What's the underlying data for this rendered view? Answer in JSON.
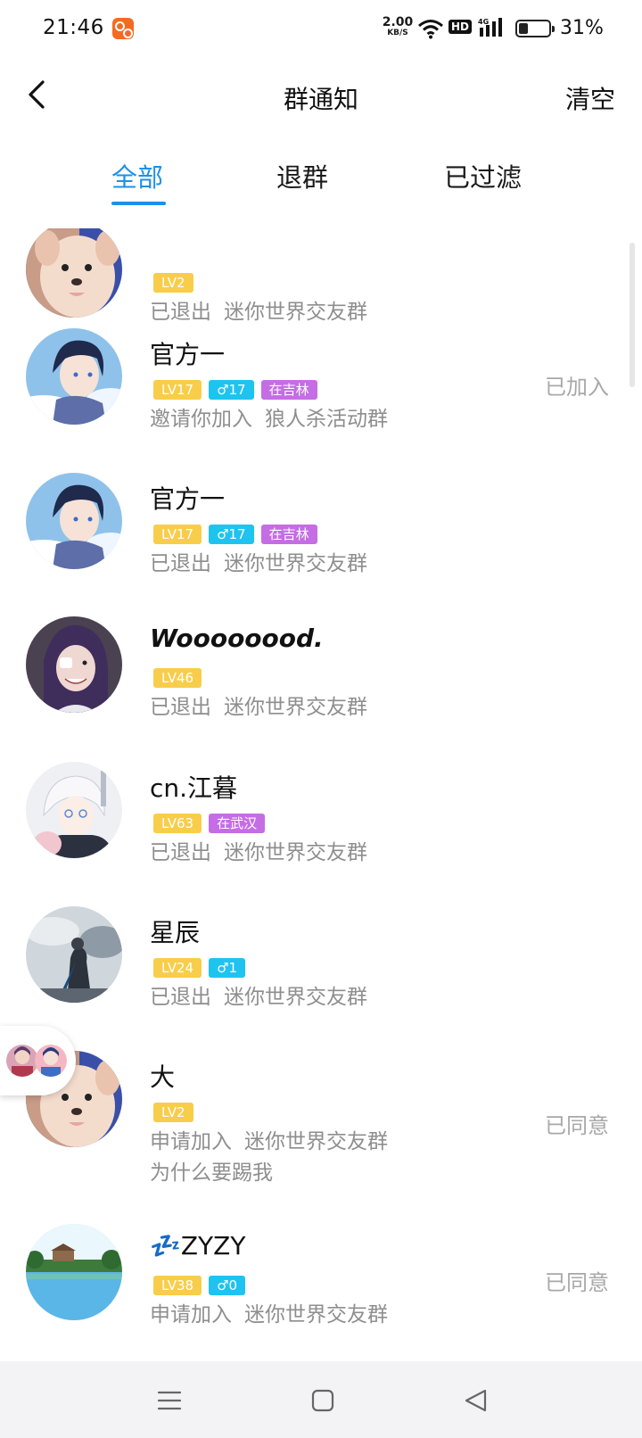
{
  "status_bar": {
    "time": "21:46",
    "net_speed": "2.00",
    "net_unit": "KB/S",
    "hd": "HD",
    "battery_pct": "31%",
    "battery_level": 0.31
  },
  "header": {
    "title": "群通知",
    "clear_label": "清空"
  },
  "tabs": [
    {
      "label": "全部",
      "active": true
    },
    {
      "label": "退群",
      "active": false
    },
    {
      "label": "已过滤",
      "active": false
    }
  ],
  "list": [
    {
      "nickname": "",
      "badges": {
        "lv": "LV2"
      },
      "action": "已退出",
      "group": "迷你世界交友群",
      "status": "",
      "avatar": "dog"
    },
    {
      "nickname": "官方一",
      "badges": {
        "lv": "LV17",
        "sex": "♂17",
        "loc": "在吉林"
      },
      "action": "邀请你加入",
      "group": "狼人杀活动群",
      "status": "已加入",
      "avatar": "anime-boy"
    },
    {
      "nickname": "官方一",
      "badges": {
        "lv": "LV17",
        "sex": "♂17",
        "loc": "在吉林"
      },
      "action": "已退出",
      "group": "迷你世界交友群",
      "status": "",
      "avatar": "anime-boy"
    },
    {
      "nickname": "Woooooood.",
      "badges": {
        "lv": "LV46"
      },
      "action": "已退出",
      "group": "迷你世界交友群",
      "status": "",
      "avatar": "cosplay-girl"
    },
    {
      "nickname": "cn.江暮",
      "badges": {
        "lv": "LV63",
        "loc": "在武汉"
      },
      "action": "已退出",
      "group": "迷你世界交友群",
      "status": "",
      "avatar": "white-hair"
    },
    {
      "nickname": "星辰",
      "badges": {
        "lv": "LV24",
        "sex": "♂1"
      },
      "action": "已退出",
      "group": "迷你世界交友群",
      "status": "",
      "avatar": "dark-hero"
    },
    {
      "nickname": "大",
      "badges": {
        "lv": "LV2"
      },
      "action": "申请加入",
      "group": "迷你世界交友群",
      "extra": "为什么要踢我",
      "status": "已同意",
      "avatar": "dog"
    },
    {
      "nickname": "💤ZYZY",
      "badges": {
        "lv": "LV38",
        "sex": "♂0"
      },
      "action": "申请加入",
      "group": "迷你世界交友群",
      "status": "已同意",
      "avatar": "landscape"
    }
  ],
  "icons": {
    "back": "chevron-left-icon",
    "nav_menu": "menu-icon",
    "nav_home": "home-square-icon",
    "nav_back": "triangle-back-icon"
  },
  "colors": {
    "accent": "#1e90e6",
    "lv_badge": "#f8cd4a",
    "sex_badge": "#1ec4ef",
    "loc_badge": "#c46de4",
    "muted_text": "#8e8e8e"
  }
}
